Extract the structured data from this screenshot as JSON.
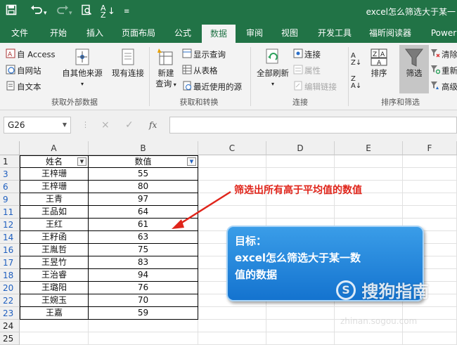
{
  "window": {
    "title": "excel怎么筛选大于某一",
    "quick_access": {
      "save_icon": "save-icon",
      "undo_icon": "undo-icon",
      "redo_icon": "redo-icon",
      "preview_icon": "print-preview-icon",
      "sort_icon": "sort-az-icon",
      "more_icon": "customize-icon"
    }
  },
  "tabs": [
    "文件",
    "开始",
    "插入",
    "页面布局",
    "公式",
    "数据",
    "审阅",
    "视图",
    "开发工具",
    "福昕阅读器",
    "Power"
  ],
  "active_tab": "数据",
  "ribbon": {
    "get_external": {
      "access": "自 Access",
      "web": "自网站",
      "text": "自文本",
      "other": "自其他来源",
      "existing": "现有连接",
      "label": "获取外部数据"
    },
    "get_transform": {
      "new_query_1": "新建",
      "new_query_2": "查询",
      "show_queries": "显示查询",
      "from_table": "从表格",
      "recent_sources": "最近使用的源",
      "label": "获取和转换"
    },
    "connections": {
      "refresh_all": "全部刷新",
      "connections": "连接",
      "properties": "属性",
      "edit_links": "编辑链接",
      "label": "连接"
    },
    "sort_filter": {
      "sort": "排序",
      "filter": "筛选",
      "clear": "清除",
      "reapply": "重新",
      "advanced": "高级",
      "label": "排序和筛选"
    }
  },
  "formula_bar": {
    "name_box": "G26",
    "cancel": "×",
    "enter": "✓",
    "fx": "fx",
    "formula": ""
  },
  "columns": [
    "A",
    "B",
    "C",
    "D",
    "E",
    "F"
  ],
  "header_row": {
    "row": "1",
    "name": "姓名",
    "value": "数值"
  },
  "rows": [
    {
      "row": "3",
      "name": "王梓珊",
      "value": "55"
    },
    {
      "row": "6",
      "name": "王梓珊",
      "value": "80"
    },
    {
      "row": "9",
      "name": "王青",
      "value": "97"
    },
    {
      "row": "11",
      "name": "王品如",
      "value": "64"
    },
    {
      "row": "12",
      "name": "王红",
      "value": "61"
    },
    {
      "row": "14",
      "name": "王籽函",
      "value": "63"
    },
    {
      "row": "16",
      "name": "王胤哲",
      "value": "75"
    },
    {
      "row": "17",
      "name": "王昱竹",
      "value": "83"
    },
    {
      "row": "18",
      "name": "王治睿",
      "value": "94"
    },
    {
      "row": "20",
      "name": "王璐阳",
      "value": "76"
    },
    {
      "row": "22",
      "name": "王婉玉",
      "value": "70"
    },
    {
      "row": "23",
      "name": "王嘉",
      "value": "59"
    }
  ],
  "empty_rows": [
    "24",
    "25"
  ],
  "annotation": {
    "arrow_text": "筛选出所有高于平均值的数值",
    "goal_title": "目标：",
    "goal_line1": "excel怎么筛选大于某一数",
    "goal_line2": "值的数据"
  },
  "watermark": {
    "text": "搜狗指南",
    "sub": "zhinan.sogou.com"
  },
  "colors": {
    "excel_green": "#217346",
    "annotation_red": "#e0251b",
    "bubble_blue": "#1f86dd",
    "filtered_row_blue": "#1f5fbf"
  }
}
